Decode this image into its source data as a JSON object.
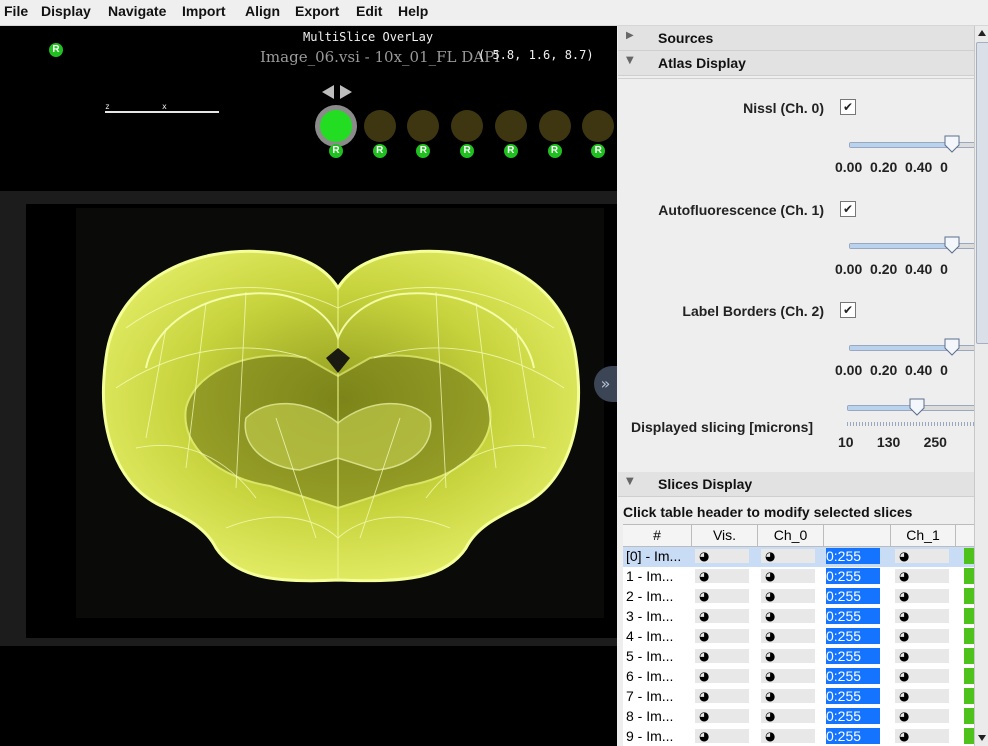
{
  "menu": [
    "File",
    "Display",
    "Navigate",
    "Import",
    "Align",
    "Export",
    "Edit",
    "Help"
  ],
  "viewer": {
    "overlay_title": "MultiSlice OverLay",
    "coords": "( 5.8, 1.6, 8.7)",
    "image_name": "Image_06.vsi - 10x_01_FL DAPI",
    "scale_labels": [
      "z",
      "x"
    ],
    "badge_letter": "R",
    "slice_count": 7,
    "current_slice_index": 0,
    "colors": {
      "section_fill": "#c8d43a",
      "badge": "#21c021",
      "current_slice": "#22dd22",
      "other_slice": "#3d3610"
    }
  },
  "panel": {
    "sources_label": "Sources",
    "atlas_label": "Atlas Display",
    "channels": [
      {
        "label": "Nissl (Ch. 0)",
        "checked": true,
        "slider_value": 0.82
      },
      {
        "label": "Autofluorescence (Ch. 1)",
        "checked": true,
        "slider_value": 0.82
      },
      {
        "label": "Label Borders (Ch. 2)",
        "checked": true,
        "slider_value": 0.82
      }
    ],
    "slider_ticks": "0.00  0.20  0.40  0",
    "slicing_label": "Displayed slicing [microns]",
    "slicing_ticks": "10      130      250",
    "slicing_value": 0.55,
    "slices_label": "Slices Display",
    "table_caption": "Click table header to modify selected slices",
    "table_headers": [
      "#",
      "Vis.",
      "Ch_0",
      "",
      "Ch_1",
      ""
    ],
    "rows": [
      "[0] - Im...",
      "1 - Im...",
      "2 - Im...",
      "3 - Im...",
      "4 - Im...",
      "5 - Im...",
      "6 - Im...",
      "7 - Im...",
      "8 - Im...",
      "9 - Im..."
    ],
    "range_text": "0:255",
    "colors": {
      "range_bg": "#1473ff",
      "green_cell": "#4cc21a"
    }
  }
}
